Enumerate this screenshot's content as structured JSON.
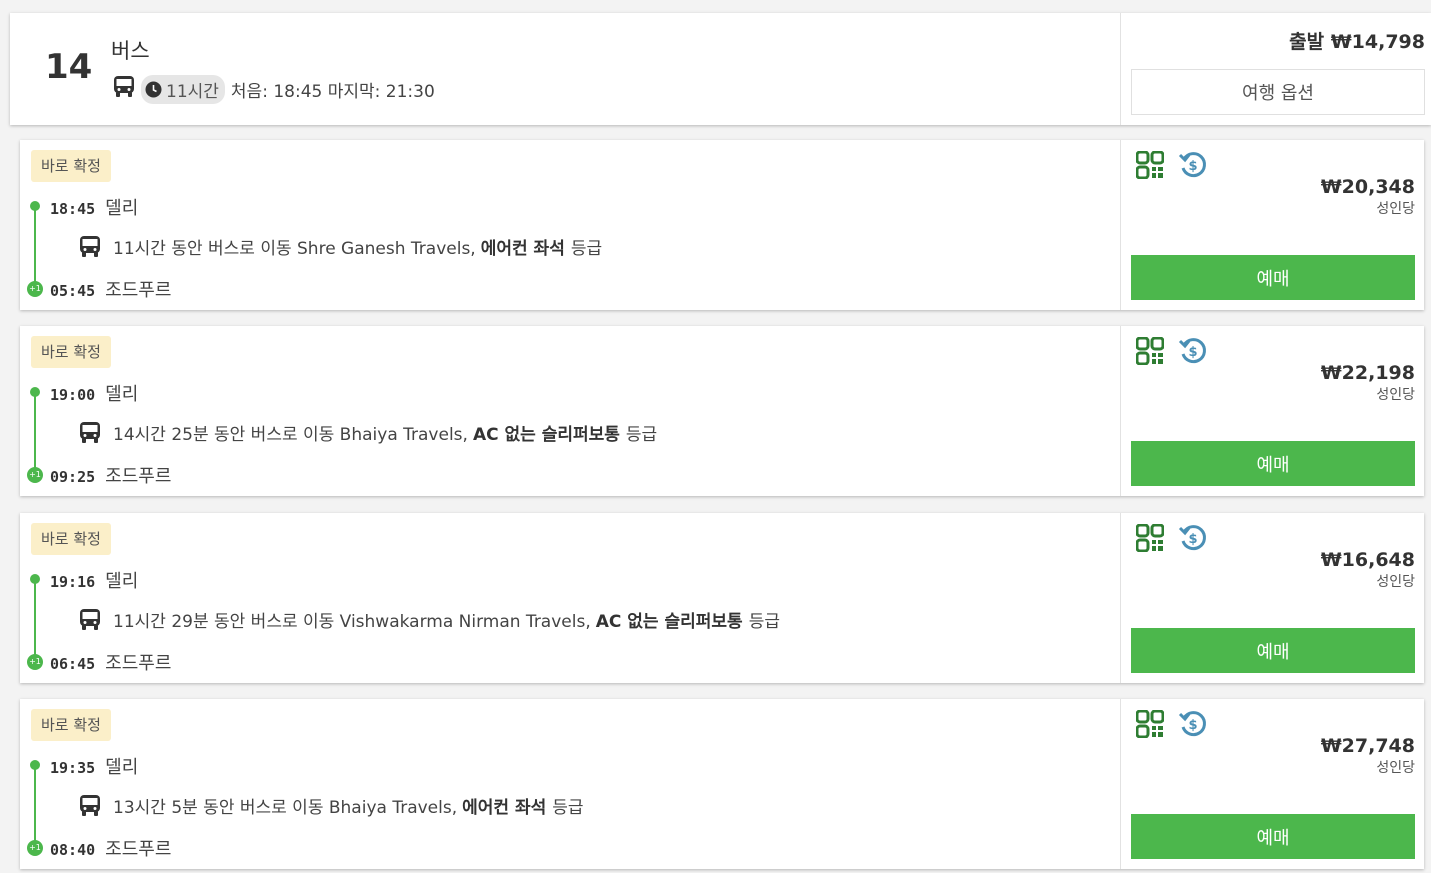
{
  "summary": {
    "count": "14",
    "mode": "버스",
    "duration": "11시간",
    "first_last": "처음: 18:45 마지막: 21:30",
    "from_price": "출발 ₩14,798",
    "options_label": "여행 옵션"
  },
  "colors": {
    "accent_green": "#4cb74c",
    "badge_bg": "#fbefc9",
    "qr_green": "#2e7d32",
    "refund_blue": "#4a8fb5"
  },
  "results": [
    {
      "badge": "바로 확정",
      "dep_time": "18:45",
      "dep_city": "델리",
      "segment": "11시간 동안 버스로 이동 Shre Ganesh Travels,",
      "class": "에어컨 좌석",
      "grade": "등급",
      "day_offset": "+1",
      "arr_time": "05:45",
      "arr_city": "조드푸르",
      "price": "₩20,348",
      "per": "성인당",
      "book": "예매",
      "icons": [
        "qr-code-icon",
        "refund-icon"
      ]
    },
    {
      "badge": "바로 확정",
      "dep_time": "19:00",
      "dep_city": "델리",
      "segment": "14시간 25분 동안 버스로 이동 Bhaiya Travels,",
      "class": "AC 없는 슬리퍼보통",
      "grade": "등급",
      "day_offset": "+1",
      "arr_time": "09:25",
      "arr_city": "조드푸르",
      "price": "₩22,198",
      "per": "성인당",
      "book": "예매",
      "icons": [
        "qr-code-icon",
        "refund-icon"
      ]
    },
    {
      "badge": "바로 확정",
      "dep_time": "19:16",
      "dep_city": "델리",
      "segment": "11시간 29분 동안 버스로 이동 Vishwakarma Nirman Travels,",
      "class": "AC 없는 슬리퍼보통",
      "grade": "등급",
      "day_offset": "+1",
      "arr_time": "06:45",
      "arr_city": "조드푸르",
      "price": "₩16,648",
      "per": "성인당",
      "book": "예매",
      "icons": [
        "qr-code-icon",
        "refund-icon"
      ]
    },
    {
      "badge": "바로 확정",
      "dep_time": "19:35",
      "dep_city": "델리",
      "segment": "13시간 5분 동안 버스로 이동 Bhaiya Travels,",
      "class": "에어컨 좌석",
      "grade": "등급",
      "day_offset": "+1",
      "arr_time": "08:40",
      "arr_city": "조드푸르",
      "price": "₩27,748",
      "per": "성인당",
      "book": "예매",
      "icons": [
        "qr-code-icon",
        "refund-icon"
      ]
    }
  ]
}
